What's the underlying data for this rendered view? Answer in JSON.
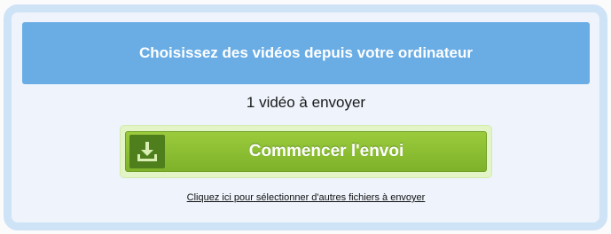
{
  "uploader": {
    "choose_label": "Choisissez des vidéos depuis votre ordinateur",
    "count_text": "1 vidéo à envoyer",
    "start_label": "Commencer l'envoi",
    "start_icon": "download-icon",
    "more_files_link": "Cliquez ici pour sélectionner d'autres fichiers à envoyer"
  },
  "colors": {
    "choose_bar": "#6aade5",
    "start_button": "#8cc03a",
    "panel_border": "#cfe3f7"
  }
}
